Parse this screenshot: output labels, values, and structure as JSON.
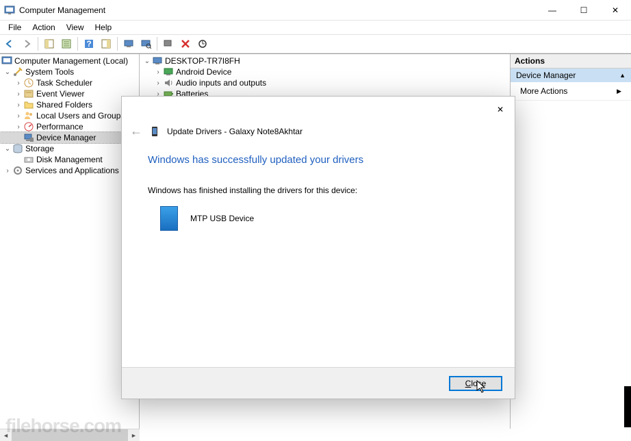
{
  "window": {
    "title": "Computer Management",
    "controls": {
      "min": "—",
      "max": "☐",
      "close": "✕"
    }
  },
  "menu": [
    "File",
    "Action",
    "View",
    "Help"
  ],
  "left_tree": {
    "root": "Computer Management (Local)",
    "system_tools": {
      "label": "System Tools",
      "children": [
        "Task Scheduler",
        "Event Viewer",
        "Shared Folders",
        "Local Users and Groups",
        "Performance",
        "Device Manager"
      ]
    },
    "storage": {
      "label": "Storage",
      "children": [
        "Disk Management"
      ]
    },
    "services": "Services and Applications"
  },
  "center_tree": {
    "root": "DESKTOP-TR7I8FH",
    "children": [
      "Android Device",
      "Audio inputs and outputs",
      "Batteries"
    ]
  },
  "actions": {
    "header": "Actions",
    "sub": "Device Manager",
    "item": "More Actions",
    "arrow_up": "▲",
    "arrow_right": "▶"
  },
  "dialog": {
    "title": "Update Drivers - Galaxy Note8Akhtar",
    "main": "Windows has successfully updated your drivers",
    "body": "Windows has finished installing the drivers for this device:",
    "device": "MTP USB Device",
    "close_btn": "Close",
    "close_x": "✕",
    "back": "←"
  },
  "watermark": "filehorse.com"
}
